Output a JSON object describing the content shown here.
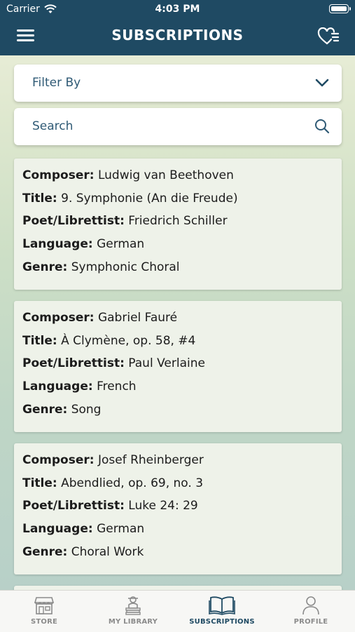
{
  "status": {
    "carrier": "Carrier",
    "time": "4:03 PM"
  },
  "header": {
    "title": "SUBSCRIPTIONS"
  },
  "filter": {
    "label": "Filter By"
  },
  "search": {
    "placeholder": "Search"
  },
  "field_labels": {
    "composer": "Composer:",
    "title": "Title:",
    "poet": "Poet/Librettist:",
    "language": "Language:",
    "genre": "Genre:"
  },
  "entries": [
    {
      "composer": "Ludwig van Beethoven",
      "title": "9. Symphonie (An die Freude)",
      "poet": "Friedrich Schiller",
      "language": "German",
      "genre": "Symphonic Choral"
    },
    {
      "composer": "Gabriel Fauré",
      "title": "À Clymène, op. 58, #4",
      "poet": "Paul Verlaine",
      "language": "French",
      "genre": "Song"
    },
    {
      "composer": "Josef Rheinberger",
      "title": "Abendlied, op. 69, no. 3",
      "poet": "Luke 24: 29",
      "language": "German",
      "genre": "Choral Work"
    }
  ],
  "tabs": [
    {
      "label": "STORE",
      "icon": "store-icon"
    },
    {
      "label": "MY LIBRARY",
      "icon": "library-icon"
    },
    {
      "label": "SUBSCRIPTIONS",
      "icon": "open-book-icon",
      "active": true
    },
    {
      "label": "PROFILE",
      "icon": "person-icon"
    }
  ],
  "colors": {
    "header": "#1f4a63",
    "accent": "#2f5a75",
    "inactive_tab": "#8b8b8b"
  }
}
